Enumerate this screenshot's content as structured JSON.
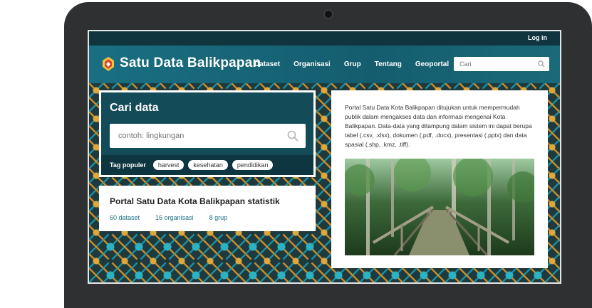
{
  "topbar": {
    "login_label": "Log in"
  },
  "header": {
    "site_title": "Satu Data Balikpapan",
    "nav": [
      "Dataset",
      "Organisasi",
      "Grup",
      "Tentang",
      "Geoportal"
    ],
    "search_placeholder": "Cari"
  },
  "search_panel": {
    "title": "Cari data",
    "placeholder": "contoh: lingkungan",
    "tags_label": "Tag populer",
    "tags": [
      "harvest",
      "kesehatan",
      "pendidikan"
    ]
  },
  "stats": {
    "title": "Portal Satu Data Kota Balikpapan statistik",
    "items": [
      "60 dataset",
      "16 organisasi",
      "8 grup"
    ]
  },
  "info": {
    "description": "Portal Satu Data Kota Balikpapan ditujukan untuk mempermudah publik dalam mengakses data dan informasi mengenai Kota Balikpapan. Data-data yang ditampung dalam sistem ini dapat berupa tabel (.csv, .xlsx), dokumen (.pdf, .docx), presentasi (.pptx) dan data spasial (.shp, .kmz, .tiff)."
  },
  "colors": {
    "header": "#1a6f82",
    "panel": "#134b59",
    "accent": "#1a6f82"
  }
}
